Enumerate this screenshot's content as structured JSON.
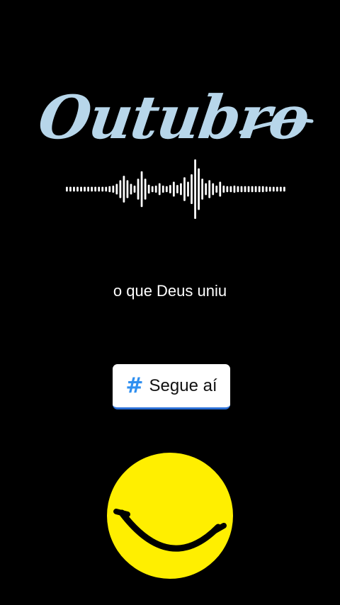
{
  "title": {
    "text": "Outubro",
    "color": "#b7d6ea"
  },
  "waveform": {
    "icon": "audio-waveform-icon",
    "color": "#ffffff",
    "levels": [
      0.08,
      0.08,
      0.08,
      0.08,
      0.08,
      0.08,
      0.08,
      0.08,
      0.08,
      0.08,
      0.08,
      0.08,
      0.1,
      0.12,
      0.18,
      0.3,
      0.45,
      0.3,
      0.18,
      0.12,
      0.35,
      0.6,
      0.35,
      0.15,
      0.1,
      0.12,
      0.2,
      0.12,
      0.1,
      0.14,
      0.25,
      0.14,
      0.2,
      0.4,
      0.25,
      0.5,
      1.0,
      0.7,
      0.35,
      0.2,
      0.3,
      0.2,
      0.12,
      0.25,
      0.12,
      0.1,
      0.1,
      0.12,
      0.1,
      0.1,
      0.1,
      0.1,
      0.1,
      0.1,
      0.1,
      0.1,
      0.09,
      0.08,
      0.08,
      0.08,
      0.08,
      0.08
    ]
  },
  "caption": {
    "text": "o que Deus uniu"
  },
  "sticker": {
    "icon": "hashtag-icon",
    "hash_symbol": "#",
    "label": "Segue aí",
    "accent": "#2f8ff0"
  },
  "smiley": {
    "icon": "smiley-face-icon",
    "fill": "#ffef00",
    "stroke": "#000000"
  }
}
